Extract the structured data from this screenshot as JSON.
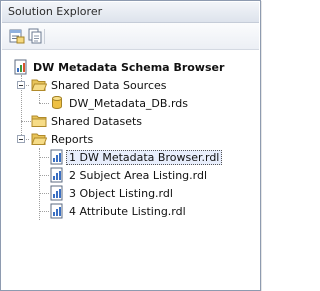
{
  "window": {
    "title": "Solution Explorer"
  },
  "toolbar": {
    "buttons": [
      {
        "name": "properties-icon"
      },
      {
        "name": "show-all-files-icon"
      }
    ]
  },
  "tree": {
    "root": {
      "label": "DW Metadata Schema Browser",
      "icon": "project-icon"
    },
    "shared_data_sources": {
      "label": "Shared Data Sources",
      "items": [
        {
          "label": "DW_Metadata_DB.rds",
          "icon": "database-icon"
        }
      ]
    },
    "shared_datasets": {
      "label": "Shared Datasets"
    },
    "reports": {
      "label": "Reports",
      "items": [
        {
          "label": "1  DW Metadata Browser.rdl",
          "selected": true
        },
        {
          "label": "2  Subject Area Listing.rdl",
          "selected": false
        },
        {
          "label": "3  Object Listing.rdl",
          "selected": false
        },
        {
          "label": "4  Attribute Listing.rdl",
          "selected": false
        }
      ]
    }
  },
  "colors": {
    "folder": "#e8c45a",
    "selection": "#e8eefc",
    "accent": "#3a6fc2"
  }
}
